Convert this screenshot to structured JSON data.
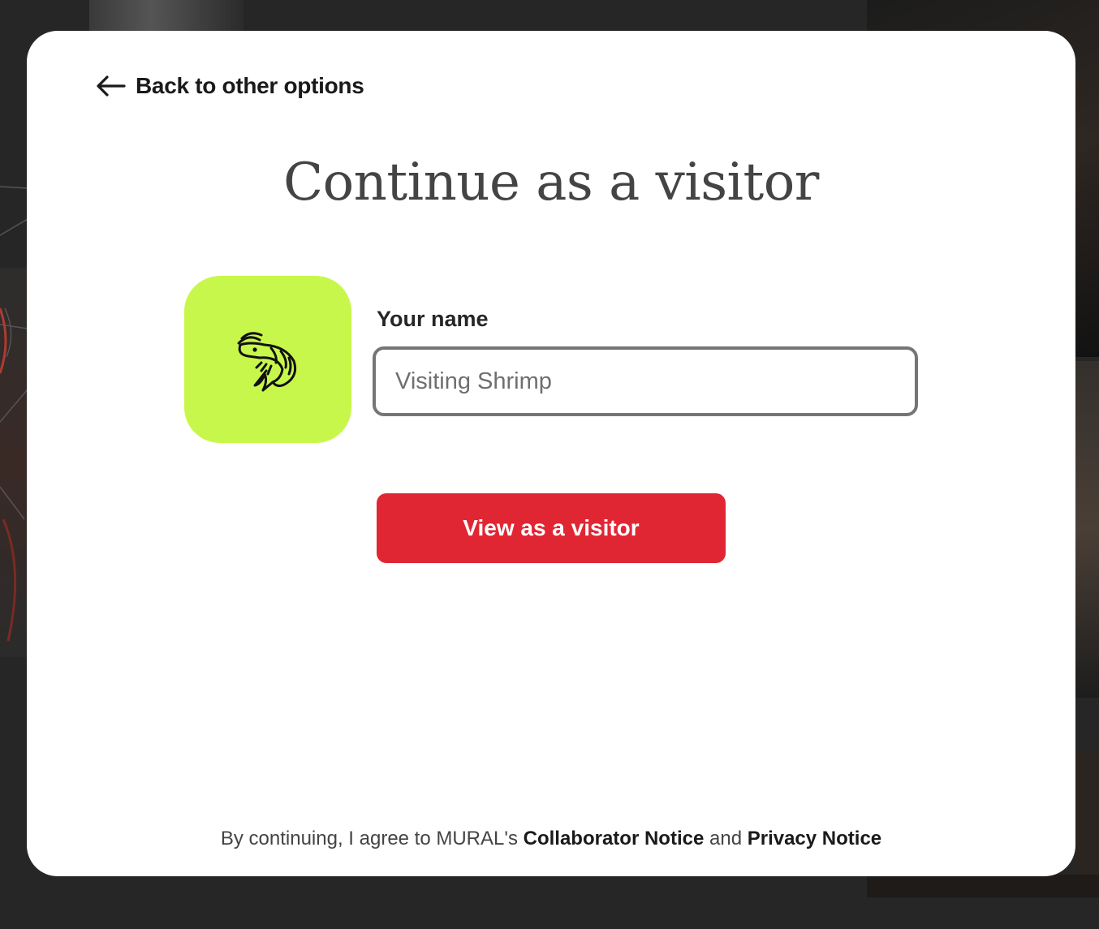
{
  "modal": {
    "back_label": "Back to other options",
    "title": "Continue as a visitor",
    "avatar_icon": "shrimp-icon",
    "avatar_color": "#c8f74b",
    "name_label": "Your name",
    "name_placeholder": "Visiting Shrimp",
    "name_value": "",
    "primary_button_label": "View as a visitor",
    "primary_button_color": "#e12633"
  },
  "legal": {
    "prefix": "By continuing, I agree to MURAL's",
    "collaborator_notice": "Collaborator Notice",
    "connector": "and",
    "privacy_notice": "Privacy Notice"
  }
}
